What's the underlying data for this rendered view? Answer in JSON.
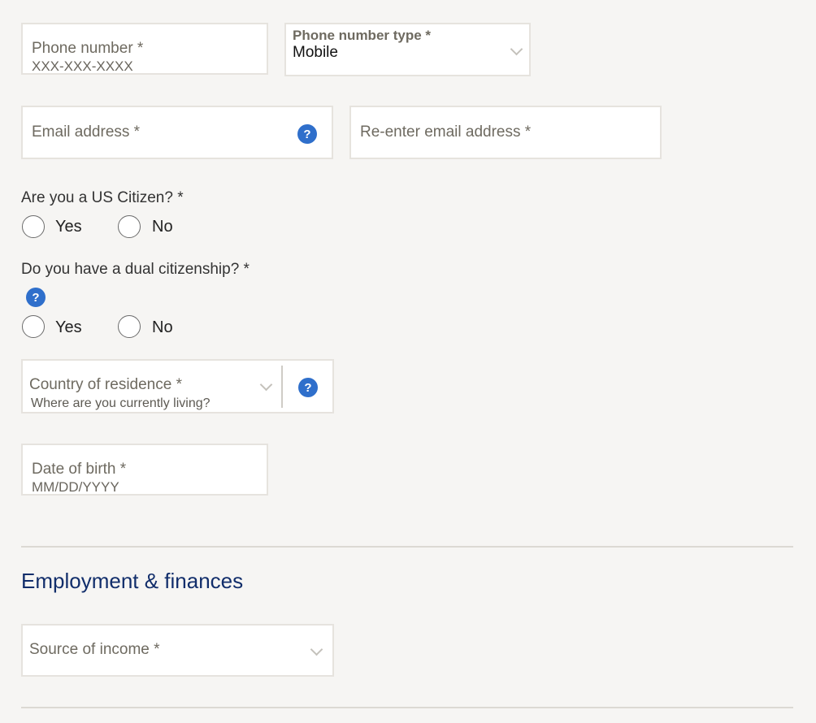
{
  "phone": {
    "label": "Phone number *",
    "placeholder": "XXX-XXX-XXXX"
  },
  "phone_type": {
    "label": "Phone number type *",
    "value": "Mobile"
  },
  "email": {
    "label": "Email address *",
    "help_icon": "?"
  },
  "reenter_email": {
    "label": "Re-enter email address *"
  },
  "us_citizen": {
    "question": "Are you a US Citizen? *",
    "options": [
      "Yes",
      "No"
    ]
  },
  "dual_citizen": {
    "question": "Do you have a dual citizenship? *",
    "help_icon": "?",
    "options": [
      "Yes",
      "No"
    ]
  },
  "country": {
    "label": "Country of residence *",
    "hint": "Where are you currently living?",
    "help_icon": "?"
  },
  "dob": {
    "label": "Date of birth *",
    "placeholder": "MM/DD/YYYY"
  },
  "employment": {
    "heading": "Employment & finances",
    "income_label": "Source of income *"
  },
  "colors": {
    "heading": "#122e6b",
    "help_icon": "#2f6fcb",
    "background": "#f6f5f3"
  }
}
